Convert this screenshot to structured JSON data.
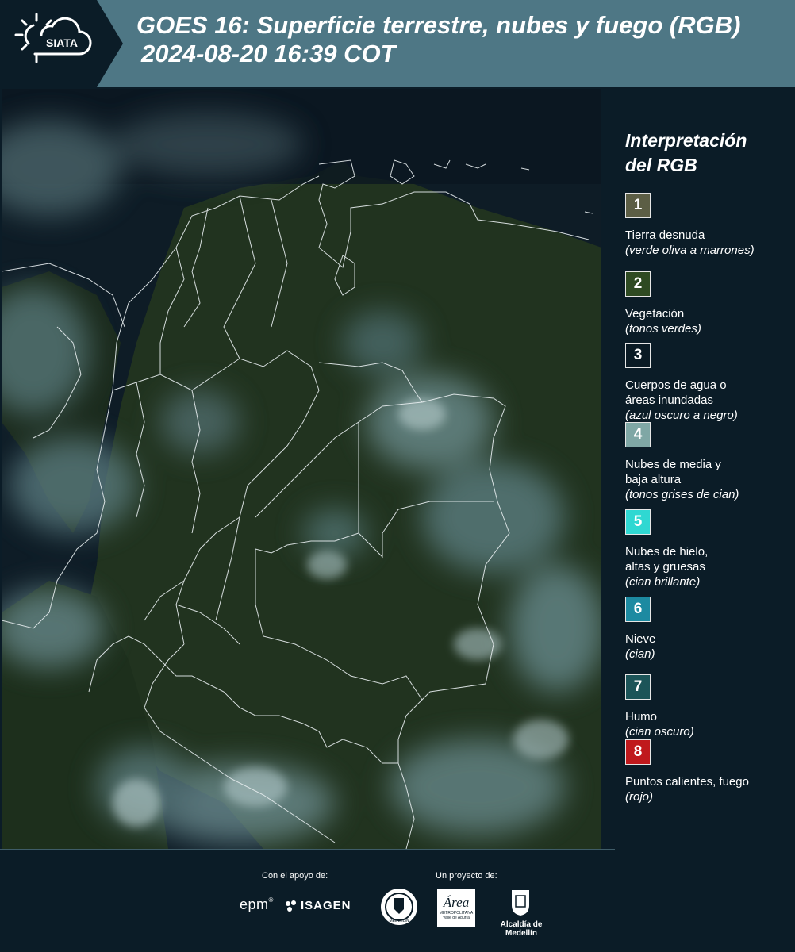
{
  "header": {
    "logo_text": "SIATA",
    "title_line1": "GOES 16: Superficie terrestre, nubes y fuego (RGB)",
    "title_line2": "2024-08-20 16:39 COT"
  },
  "legend": {
    "title_line1": "Interpretación",
    "title_line2": "del RGB",
    "items": [
      {
        "num": "1",
        "label": "Tierra desnuda",
        "sub": "(verde oliva a marrones)",
        "color": "#5c5e45"
      },
      {
        "num": "2",
        "label": "Vegetación",
        "sub": "(tonos verdes)",
        "color": "#2e4a22"
      },
      {
        "num": "3",
        "label": "Cuerpos de agua o\náreas inundadas",
        "sub": "(azul oscuro a negro)",
        "color": "#0a1a24"
      },
      {
        "num": "4",
        "label": "Nubes de media y\nbaja altura",
        "sub": "(tonos grises de cian)",
        "color": "#7fa7a5"
      },
      {
        "num": "5",
        "label": "Nubes de hielo,\naltas y gruesas",
        "sub": "(cian brillante)",
        "color": "#2fd8d2"
      },
      {
        "num": "6",
        "label": "Nieve",
        "sub": "(cian)",
        "color": "#1d8aa1"
      },
      {
        "num": "7",
        "label": "Humo",
        "sub": "(cian oscuro)",
        "color": "#1c5458"
      },
      {
        "num": "8",
        "label": "Puntos calientes, fuego",
        "sub": "(rojo)",
        "color": "#c0191c"
      }
    ]
  },
  "footer": {
    "support_label": "Con el apoyo de:",
    "project_label": "Un proyecto de:",
    "epm": "epm",
    "isagen": "ISAGEN",
    "alcaldia": "Alcaldía de Medellín",
    "area_text": "Área",
    "area_sub": "METROPOLITANA",
    "area_sub2": "Valle de Aburrá",
    "seal_text": "MEDELLÍN"
  }
}
